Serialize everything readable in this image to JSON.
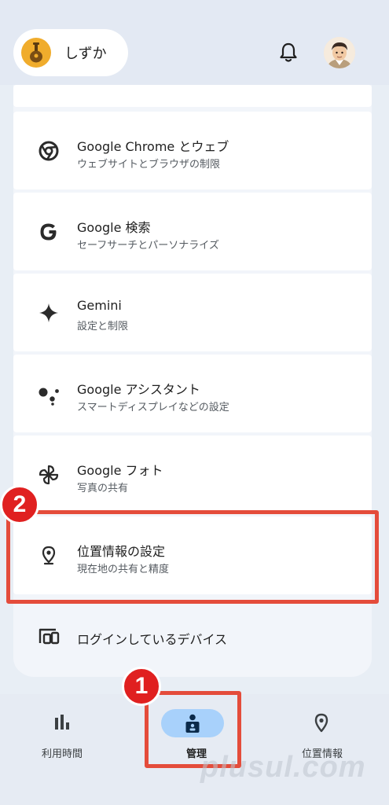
{
  "header": {
    "account_name": "しずか",
    "icons": {
      "account": "kid-account-icon",
      "bell": "bell-icon",
      "profile": "profile-avatar"
    }
  },
  "cards": [
    {
      "id": "chrome",
      "icon": "chrome-icon",
      "title": "Google Chrome とウェブ",
      "subtitle": "ウェブサイトとブラウザの制限"
    },
    {
      "id": "search",
      "icon": "google-g-icon",
      "title": "Google 検索",
      "subtitle": "セーフサーチとパーソナライズ"
    },
    {
      "id": "gemini",
      "icon": "gemini-sparkle-icon",
      "title": "Gemini",
      "subtitle": "設定と制限"
    },
    {
      "id": "assistant",
      "icon": "assistant-dots-icon",
      "title": "Google アシスタント",
      "subtitle": "スマートディスプレイなどの設定"
    },
    {
      "id": "photos",
      "icon": "photos-pinwheel-icon",
      "title": "Google フォト",
      "subtitle": "写真の共有"
    },
    {
      "id": "location",
      "icon": "location-pin-icon",
      "title": "位置情報の設定",
      "subtitle": "現在地の共有と精度"
    },
    {
      "id": "devices",
      "icon": "devices-icon",
      "title": "ログインしているデバイス",
      "subtitle": ""
    }
  ],
  "annotations": {
    "step1": "1",
    "step2": "2",
    "highlight_color": "#e44c3b"
  },
  "nav": {
    "items": [
      {
        "id": "usage",
        "icon": "bar-chart-icon",
        "label": "利用時間",
        "active": false
      },
      {
        "id": "manage",
        "icon": "manage-person-icon",
        "label": "管理",
        "active": true
      },
      {
        "id": "location",
        "icon": "location-pin-icon",
        "label": "位置情報",
        "active": false
      }
    ]
  },
  "watermark": "plusul.com",
  "colors": {
    "active_pill": "#a8d1fb",
    "account_avatar": "#f0ac2c"
  }
}
